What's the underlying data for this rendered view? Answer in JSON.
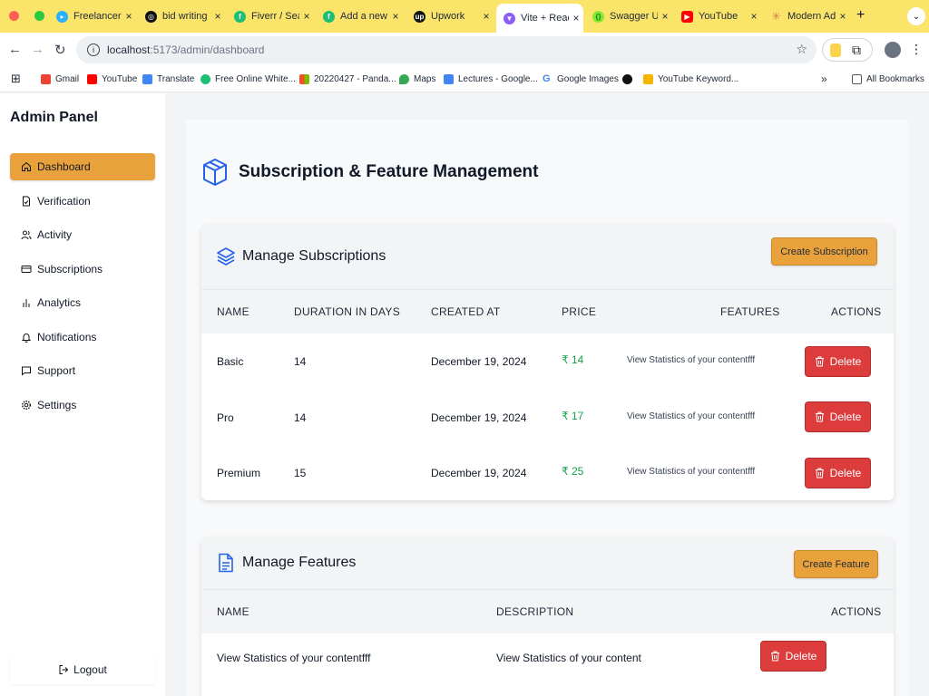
{
  "browser": {
    "tabs": [
      {
        "title": "Freelancer",
        "favicon": "freelancer-icon",
        "color": "#29b2fe"
      },
      {
        "title": "bid writing",
        "favicon": "chatgpt-icon",
        "color": "#111111"
      },
      {
        "title": "Fiverr / Sear",
        "favicon": "fiverr-icon",
        "color": "#1dbf73"
      },
      {
        "title": "Add a new p",
        "favicon": "fiverr-icon",
        "color": "#1dbf73"
      },
      {
        "title": "Upwork",
        "favicon": "upwork-icon",
        "color": "#111111"
      },
      {
        "title": "Vite + React",
        "favicon": "vite-icon",
        "color": "#8b5cf6"
      },
      {
        "title": "Swagger UI",
        "favicon": "swagger-icon",
        "color": "#85ea2d"
      },
      {
        "title": "YouTube",
        "favicon": "youtube-icon",
        "color": "#ff0000"
      },
      {
        "title": "Modern Adm",
        "favicon": "spark-icon",
        "color": "#d97757"
      }
    ],
    "url_host": "localhost",
    "url_path": ":5173/admin/dashboard",
    "bookmarks": [
      {
        "label": "Gmail",
        "icon": "gmail-icon",
        "color": "#ea4335"
      },
      {
        "label": "YouTube",
        "icon": "youtube-icon",
        "color": "#ff0000"
      },
      {
        "label": "Translate",
        "icon": "translate-icon",
        "color": "#4285f4"
      },
      {
        "label": "Free Online White...",
        "icon": "fiverr-icon",
        "color": "#1dbf73"
      },
      {
        "label": "20220427 - Panda...",
        "icon": "microsoft-icon",
        "color": "#f25022"
      },
      {
        "label": "Maps",
        "icon": "maps-icon",
        "color": "#34a853"
      },
      {
        "label": "Lectures - Google...",
        "icon": "docs-icon",
        "color": "#4285f4"
      },
      {
        "label": "Google Images",
        "icon": "google-icon",
        "color": "#4285f4"
      },
      {
        "label": "",
        "icon": "globe-icon",
        "color": "#111111"
      },
      {
        "label": "YouTube Keyword...",
        "icon": "chart-icon",
        "color": "#f4b400"
      }
    ],
    "all_bookmarks": "All Bookmarks"
  },
  "sidebar": {
    "brand": "Admin Panel",
    "items": [
      {
        "label": "Dashboard",
        "icon": "home-icon"
      },
      {
        "label": "Verification",
        "icon": "file-check-icon"
      },
      {
        "label": "Activity",
        "icon": "users-icon"
      },
      {
        "label": "Subscriptions",
        "icon": "card-icon"
      },
      {
        "label": "Analytics",
        "icon": "bar-chart-icon"
      },
      {
        "label": "Notifications",
        "icon": "bell-icon"
      },
      {
        "label": "Support",
        "icon": "message-icon"
      },
      {
        "label": "Settings",
        "icon": "gear-icon"
      }
    ],
    "logout": "Logout"
  },
  "page": {
    "title": "Subscription & Feature Management"
  },
  "subscriptions": {
    "title": "Manage Subscriptions",
    "create_label": "Create Subscription",
    "columns": [
      "NAME",
      "DURATION IN DAYS",
      "CREATED AT",
      "PRICE",
      "FEATURES",
      "ACTIONS"
    ],
    "rows": [
      {
        "name": "Basic",
        "duration": "14",
        "created": "December 19, 2024",
        "price": "₹ 14",
        "features": "View Statistics of your contentfff",
        "action": "Delete"
      },
      {
        "name": "Pro",
        "duration": "14",
        "created": "December 19, 2024",
        "price": "₹ 17",
        "features": "View Statistics of your contentfff",
        "action": "Delete"
      },
      {
        "name": "Premium",
        "duration": "15",
        "created": "December 19, 2024",
        "price": "₹ 25",
        "features": "View Statistics of your contentfff",
        "action": "Delete"
      }
    ]
  },
  "features": {
    "title": "Manage Features",
    "create_label": "Create Feature",
    "columns": [
      "NAME",
      "DESCRIPTION",
      "ACTIONS"
    ],
    "rows": [
      {
        "name": "View Statistics of your contentfff",
        "description": "View Statistics of your content",
        "action": "Delete"
      }
    ]
  },
  "colors": {
    "accent": "#e9a23b",
    "danger": "#dc3c3c",
    "price": "#16a34a",
    "icon_blue": "#2563eb",
    "tab_strip": "#fbe46a"
  }
}
